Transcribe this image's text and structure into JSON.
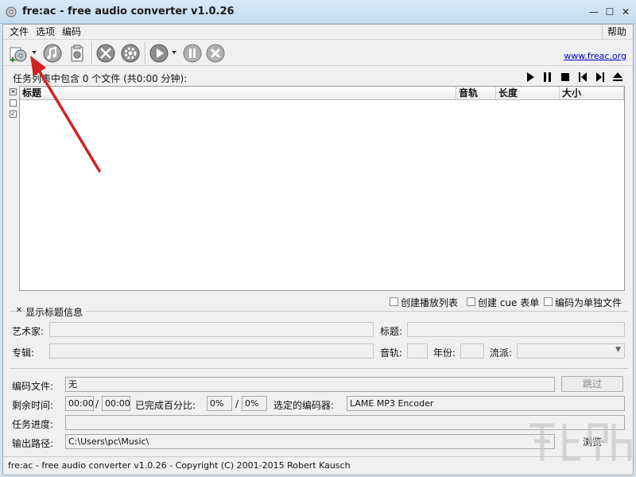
{
  "window": {
    "title": "fre:ac - free audio converter v1.0.26",
    "minimize": "—",
    "maximize": "☐",
    "close": "✕"
  },
  "menu": {
    "file": "文件",
    "options": "选项",
    "encode": "编码",
    "help": "帮助"
  },
  "toolbar": {
    "website": "www.freac.org",
    "icons": [
      "add-files-icon",
      "cd-ripper-icon",
      "remove-icon",
      "settings-icon",
      "config-gear-icon",
      "play-encode-icon",
      "pause-icon",
      "stop-icon"
    ]
  },
  "joblist": {
    "info": "任务列表中包含 0 个文件 (共0:00 分钟):",
    "columns": [
      "标题",
      "音轨",
      "长度",
      "大小"
    ],
    "rows": []
  },
  "list_options": {
    "create_playlist": "创建播放列表",
    "create_cue": "创建 cue 表单",
    "encode_single": "编码为单独文件"
  },
  "title_info": {
    "show_label": "显示标题信息",
    "show_checked": true,
    "artist_label": "艺术家:",
    "title_label": "标题:",
    "album_label": "专辑:",
    "track_label": "音轨:",
    "year_label": "年份:",
    "genre_label": "流派:",
    "artist": "",
    "title": "",
    "album": "",
    "track": "",
    "year": "",
    "genre": ""
  },
  "progress": {
    "encoding_file_label": "编码文件:",
    "encoding_file": "无",
    "skip": "跳过",
    "time_left_label": "剩余时间:",
    "time_left": "00:00",
    "time_total": "00:00",
    "slash": "/",
    "percent_label": "已完成百分比:",
    "percent_file": "0%",
    "percent_total": "0%",
    "encoder_label": "选定的编码器:",
    "encoder": "LAME MP3 Encoder",
    "job_progress_label": "任务进度:",
    "output_label": "输出路径:",
    "output_path": "C:\\Users\\pc\\Music\\",
    "browse": "浏览"
  },
  "status": {
    "text": "fre:ac - free audio converter v1.0.26 - Copyright (C) 2001-2015 Robert Kausch"
  },
  "colors": {
    "arrow": "#d42020",
    "link": "#0000cc"
  }
}
